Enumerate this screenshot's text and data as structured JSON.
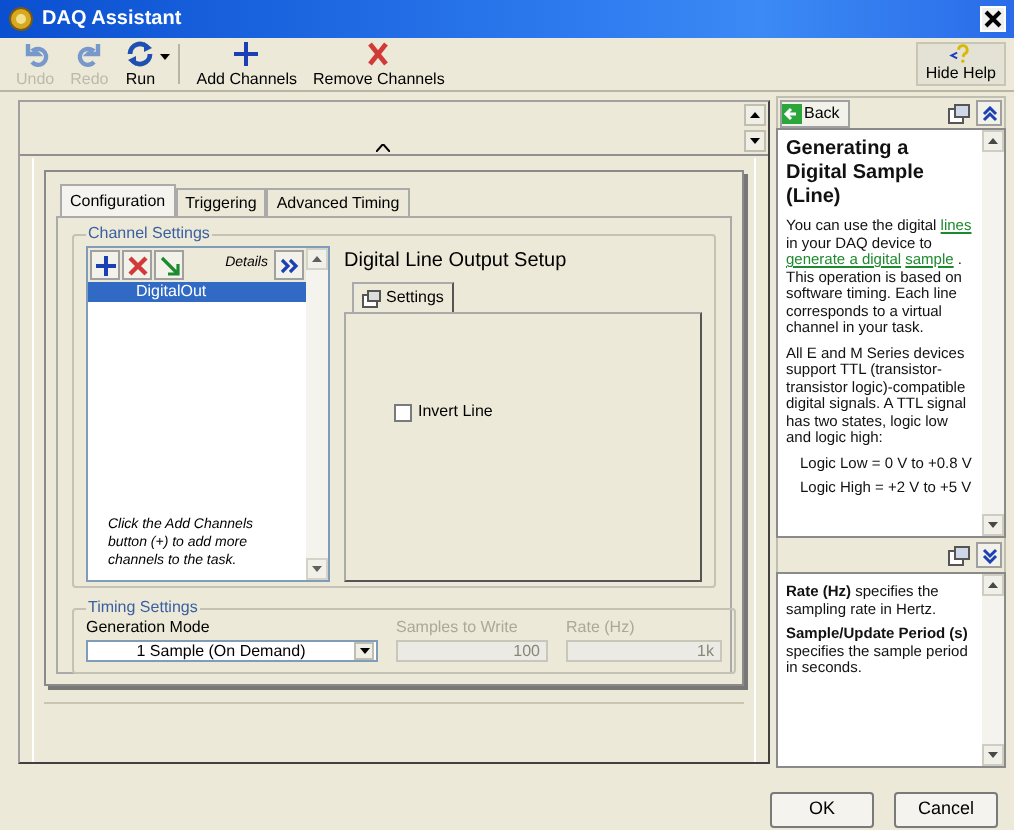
{
  "window": {
    "title": "DAQ Assistant"
  },
  "toolbar": [
    {
      "kind": "undo",
      "label": "Undo",
      "disabled": true
    },
    {
      "kind": "redo",
      "label": "Redo",
      "disabled": true
    },
    {
      "kind": "run",
      "label": "Run",
      "disabled": false
    },
    {
      "kind": "add",
      "label": "Add Channels",
      "disabled": false
    },
    {
      "kind": "remove",
      "label": "Remove Channels",
      "disabled": false
    }
  ],
  "hide_help": {
    "label": "Hide Help"
  },
  "tabs": [
    {
      "label": "Configuration",
      "selected": true
    },
    {
      "label": "Triggering",
      "selected": false
    },
    {
      "label": "Advanced Timing",
      "selected": false
    }
  ],
  "channel_settings": {
    "title": "Channel Settings",
    "details": "Details",
    "channels": [
      {
        "name": "DigitalOut",
        "selected": true
      }
    ],
    "hint": "Click the Add Channels button (+) to add more channels to the task."
  },
  "setup": {
    "title": "Digital Line Output Setup",
    "tabs": [
      {
        "label": "Settings",
        "selected": true
      }
    ],
    "invert_line": {
      "label": "Invert Line",
      "checked": false
    }
  },
  "timing": {
    "title": "Timing Settings",
    "generation_mode": {
      "label": "Generation Mode",
      "value": "1 Sample (On Demand)"
    },
    "samples_to_write": {
      "label": "Samples to Write",
      "value": "100",
      "disabled": true
    },
    "rate": {
      "label": "Rate (Hz)",
      "value": "1k",
      "disabled": true
    }
  },
  "help": {
    "back": "Back",
    "heading": "Generating a Digital Sample (Line)",
    "paragraphs": [
      [
        {
          "kind": "text",
          "text": "You can use the digital "
        },
        {
          "kind": "link",
          "text": "lines"
        },
        {
          "kind": "text",
          "text": " in your DAQ device to "
        },
        {
          "kind": "link",
          "text": "generate a digital"
        },
        {
          "kind": "link",
          "text": "sample"
        },
        {
          "kind": "text",
          "text": ". This operation is based on software timing. Each line corresponds to a virtual channel in your task."
        }
      ],
      [
        {
          "kind": "text",
          "text": "All E and M Series devices support TTL (transistor-transistor logic)-compatible digital signals. A TTL signal has two states, logic low and logic high:"
        }
      ],
      [
        {
          "kind": "indent",
          "text": "Logic Low = 0 V to +0.8 V"
        }
      ],
      [
        {
          "kind": "indent",
          "text": "Logic High = +2 V to +5 V"
        }
      ]
    ],
    "detail": [
      "**Rate (Hz)** specifies the sampling rate in Hertz.",
      "**Sample/Update Period (s)** specifies the sample period in seconds."
    ]
  },
  "buttons": [
    "OK",
    "Cancel"
  ]
}
